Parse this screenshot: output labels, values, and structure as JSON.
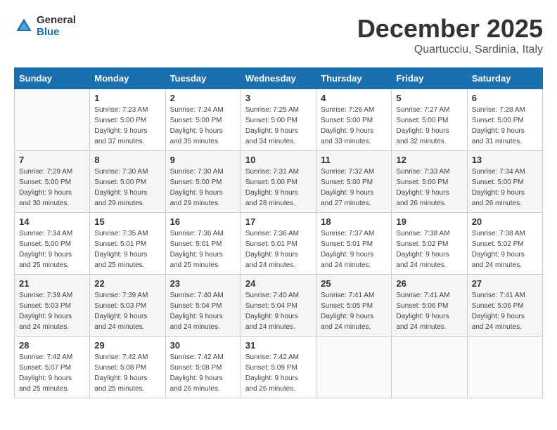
{
  "logo": {
    "line1": "General",
    "line2": "Blue"
  },
  "title": "December 2025",
  "location": "Quartucciu, Sardinia, Italy",
  "weekdays": [
    "Sunday",
    "Monday",
    "Tuesday",
    "Wednesday",
    "Thursday",
    "Friday",
    "Saturday"
  ],
  "weeks": [
    [
      {
        "day": "",
        "info": ""
      },
      {
        "day": "1",
        "info": "Sunrise: 7:23 AM\nSunset: 5:00 PM\nDaylight: 9 hours\nand 37 minutes."
      },
      {
        "day": "2",
        "info": "Sunrise: 7:24 AM\nSunset: 5:00 PM\nDaylight: 9 hours\nand 35 minutes."
      },
      {
        "day": "3",
        "info": "Sunrise: 7:25 AM\nSunset: 5:00 PM\nDaylight: 9 hours\nand 34 minutes."
      },
      {
        "day": "4",
        "info": "Sunrise: 7:26 AM\nSunset: 5:00 PM\nDaylight: 9 hours\nand 33 minutes."
      },
      {
        "day": "5",
        "info": "Sunrise: 7:27 AM\nSunset: 5:00 PM\nDaylight: 9 hours\nand 32 minutes."
      },
      {
        "day": "6",
        "info": "Sunrise: 7:28 AM\nSunset: 5:00 PM\nDaylight: 9 hours\nand 31 minutes."
      }
    ],
    [
      {
        "day": "7",
        "info": "Sunrise: 7:29 AM\nSunset: 5:00 PM\nDaylight: 9 hours\nand 30 minutes."
      },
      {
        "day": "8",
        "info": "Sunrise: 7:30 AM\nSunset: 5:00 PM\nDaylight: 9 hours\nand 29 minutes."
      },
      {
        "day": "9",
        "info": "Sunrise: 7:30 AM\nSunset: 5:00 PM\nDaylight: 9 hours\nand 29 minutes."
      },
      {
        "day": "10",
        "info": "Sunrise: 7:31 AM\nSunset: 5:00 PM\nDaylight: 9 hours\nand 28 minutes."
      },
      {
        "day": "11",
        "info": "Sunrise: 7:32 AM\nSunset: 5:00 PM\nDaylight: 9 hours\nand 27 minutes."
      },
      {
        "day": "12",
        "info": "Sunrise: 7:33 AM\nSunset: 5:00 PM\nDaylight: 9 hours\nand 26 minutes."
      },
      {
        "day": "13",
        "info": "Sunrise: 7:34 AM\nSunset: 5:00 PM\nDaylight: 9 hours\nand 26 minutes."
      }
    ],
    [
      {
        "day": "14",
        "info": "Sunrise: 7:34 AM\nSunset: 5:00 PM\nDaylight: 9 hours\nand 25 minutes."
      },
      {
        "day": "15",
        "info": "Sunrise: 7:35 AM\nSunset: 5:01 PM\nDaylight: 9 hours\nand 25 minutes."
      },
      {
        "day": "16",
        "info": "Sunrise: 7:36 AM\nSunset: 5:01 PM\nDaylight: 9 hours\nand 25 minutes."
      },
      {
        "day": "17",
        "info": "Sunrise: 7:36 AM\nSunset: 5:01 PM\nDaylight: 9 hours\nand 24 minutes."
      },
      {
        "day": "18",
        "info": "Sunrise: 7:37 AM\nSunset: 5:01 PM\nDaylight: 9 hours\nand 24 minutes."
      },
      {
        "day": "19",
        "info": "Sunrise: 7:38 AM\nSunset: 5:02 PM\nDaylight: 9 hours\nand 24 minutes."
      },
      {
        "day": "20",
        "info": "Sunrise: 7:38 AM\nSunset: 5:02 PM\nDaylight: 9 hours\nand 24 minutes."
      }
    ],
    [
      {
        "day": "21",
        "info": "Sunrise: 7:39 AM\nSunset: 5:03 PM\nDaylight: 9 hours\nand 24 minutes."
      },
      {
        "day": "22",
        "info": "Sunrise: 7:39 AM\nSunset: 5:03 PM\nDaylight: 9 hours\nand 24 minutes."
      },
      {
        "day": "23",
        "info": "Sunrise: 7:40 AM\nSunset: 5:04 PM\nDaylight: 9 hours\nand 24 minutes."
      },
      {
        "day": "24",
        "info": "Sunrise: 7:40 AM\nSunset: 5:04 PM\nDaylight: 9 hours\nand 24 minutes."
      },
      {
        "day": "25",
        "info": "Sunrise: 7:41 AM\nSunset: 5:05 PM\nDaylight: 9 hours\nand 24 minutes."
      },
      {
        "day": "26",
        "info": "Sunrise: 7:41 AM\nSunset: 5:06 PM\nDaylight: 9 hours\nand 24 minutes."
      },
      {
        "day": "27",
        "info": "Sunrise: 7:41 AM\nSunset: 5:06 PM\nDaylight: 9 hours\nand 24 minutes."
      }
    ],
    [
      {
        "day": "28",
        "info": "Sunrise: 7:42 AM\nSunset: 5:07 PM\nDaylight: 9 hours\nand 25 minutes."
      },
      {
        "day": "29",
        "info": "Sunrise: 7:42 AM\nSunset: 5:08 PM\nDaylight: 9 hours\nand 25 minutes."
      },
      {
        "day": "30",
        "info": "Sunrise: 7:42 AM\nSunset: 5:08 PM\nDaylight: 9 hours\nand 26 minutes."
      },
      {
        "day": "31",
        "info": "Sunrise: 7:42 AM\nSunset: 5:09 PM\nDaylight: 9 hours\nand 26 minutes."
      },
      {
        "day": "",
        "info": ""
      },
      {
        "day": "",
        "info": ""
      },
      {
        "day": "",
        "info": ""
      }
    ]
  ]
}
